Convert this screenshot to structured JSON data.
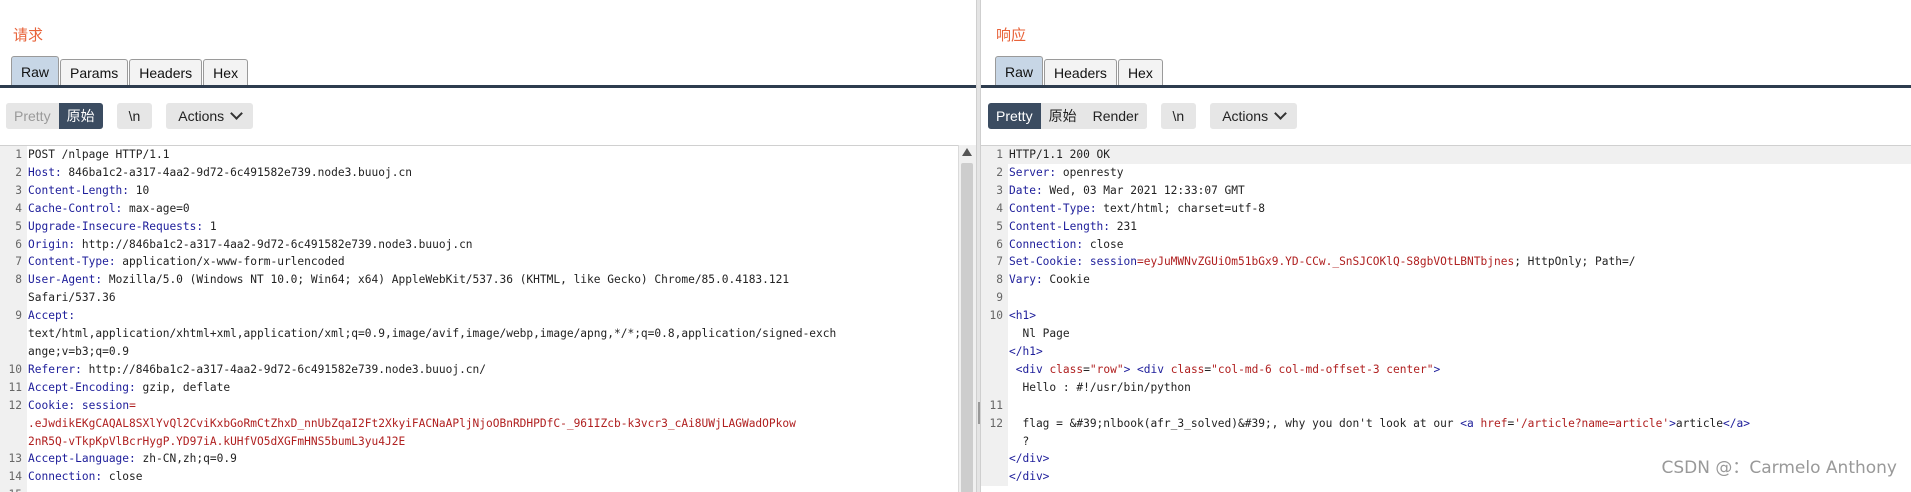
{
  "request": {
    "title": "请求",
    "tabs": [
      "Raw",
      "Params",
      "Headers",
      "Hex"
    ],
    "active_tab": 0,
    "toolbar": {
      "pretty": "Pretty",
      "raw": "原始",
      "newline": "\\n",
      "actions": "Actions"
    },
    "lines": [
      {
        "n": "1",
        "t": "POST /nlpage HTTP/1.1"
      },
      {
        "n": "2",
        "k": "Host",
        "v": " 846ba1c2-a317-4aa2-9d72-6c491582e739.node3.buuoj.cn"
      },
      {
        "n": "3",
        "k": "Content-Length",
        "v": " 10"
      },
      {
        "n": "4",
        "k": "Cache-Control",
        "v": " max-age=0"
      },
      {
        "n": "5",
        "k": "Upgrade-Insecure-Requests",
        "v": " 1"
      },
      {
        "n": "6",
        "k": "Origin",
        "v": " http://846ba1c2-a317-4aa2-9d72-6c491582e739.node3.buuoj.cn"
      },
      {
        "n": "7",
        "k": "Content-Type",
        "v": " application/x-www-form-urlencoded"
      },
      {
        "n": "8",
        "k": "User-Agent",
        "v": " Mozilla/5.0 (Windows NT 10.0; Win64; x64) AppleWebKit/537.36 (KHTML, like Gecko) Chrome/85.0.4183.121"
      },
      {
        "n": "",
        "t": "Safari/537.36"
      },
      {
        "n": "9",
        "k": "Accept",
        "v": ""
      },
      {
        "n": "",
        "t": "text/html,application/xhtml+xml,application/xml;q=0.9,image/avif,image/webp,image/apng,*/*;q=0.8,application/signed-exch"
      },
      {
        "n": "",
        "t": "ange;v=b3;q=0.9"
      },
      {
        "n": "10",
        "k": "Referer",
        "v": " http://846ba1c2-a317-4aa2-9d72-6c491582e739.node3.buuoj.cn/"
      },
      {
        "n": "11",
        "k": "Accept-Encoding",
        "v": " gzip, deflate"
      },
      {
        "n": "12",
        "k": "Cookie",
        "v": " ",
        "ck": "session",
        "cv": "="
      },
      {
        "n": "",
        "c": ".eJwdikEKgCAQAL8SXlYvQl2CviKxbGoRmCtZhxD_nnUbZqaI2Ft2XkyiFACNaAPljNjoOBnRDHPDfC-_961IZcb-k3vcr3_cAi8UWjLAGWadOPkow"
      },
      {
        "n": "",
        "c": "2nR5Q-vTkpKpVlBcrHygP.YD97iA.kUHfVO5dXGFmHNS5bumL3yu4J2E"
      },
      {
        "n": "13",
        "k": "Accept-Language",
        "v": " zh-CN,zh;q=0.9"
      },
      {
        "n": "14",
        "k": "Connection",
        "v": " close"
      },
      {
        "n": "15",
        "t": ""
      }
    ]
  },
  "response": {
    "title": "响应",
    "tabs": [
      "Raw",
      "Headers",
      "Hex"
    ],
    "active_tab": 0,
    "toolbar": {
      "pretty": "Pretty",
      "raw": "原始",
      "render": "Render",
      "newline": "\\n",
      "actions": "Actions"
    },
    "lines": [
      {
        "n": "1",
        "t": "HTTP/1.1 200 OK"
      },
      {
        "n": "2",
        "k": "Server",
        "v": " openresty"
      },
      {
        "n": "3",
        "k": "Date",
        "v": " Wed, 03 Mar 2021 12:33:07 GMT"
      },
      {
        "n": "4",
        "k": "Content-Type",
        "v": " text/html; charset=utf-8"
      },
      {
        "n": "5",
        "k": "Content-Length",
        "v": " 231"
      },
      {
        "n": "6",
        "k": "Connection",
        "v": " close"
      },
      {
        "n": "7",
        "k": "Set-Cookie",
        "v": " ",
        "ck": "session",
        "cv": "=eyJuMWNvZGUiOm51bGx9.YD-CCw._SnSJCOKlQ-S8gbVOtLBNTbjnes",
        "rest": "; HttpOnly; Path=/"
      },
      {
        "n": "8",
        "k": "Vary",
        "v": " Cookie"
      },
      {
        "n": "9",
        "t": ""
      },
      {
        "n": "10",
        "tag": "<h1>"
      },
      {
        "n": "",
        "t": "  Nl Page"
      },
      {
        "n": "",
        "tag": "</h1>"
      },
      {
        "n": "",
        "html": [
          " ",
          "<div ",
          "class",
          "=",
          "\"row\"",
          "> ",
          "<div ",
          "class",
          "=",
          "\"col-md-6 col-md-offset-3 center\"",
          ">"
        ]
      },
      {
        "n": "",
        "t": "  Hello : #!/usr/bin/python"
      },
      {
        "n": "11",
        "t": ""
      },
      {
        "n": "12",
        "html": [
          "  flag = &#39;nlbook(afr_3_solved)&#39;, why you don't look at our ",
          "<a ",
          "href",
          "=",
          "'/article?name=article'",
          ">",
          "article",
          "</a>"
        ]
      },
      {
        "n": "",
        "t": "  ?"
      },
      {
        "n": "",
        "tag": "</div>"
      },
      {
        "n": "",
        "t": ""
      },
      {
        "n": "",
        "tag": "</div>"
      }
    ]
  },
  "watermark": "CSDN @：Carmelo Anthony",
  "colors": {
    "accent_title": "#e8633a",
    "active_button": "#3b4c61",
    "header_key": "#1d1d9a",
    "cookie_value": "#b02020"
  }
}
